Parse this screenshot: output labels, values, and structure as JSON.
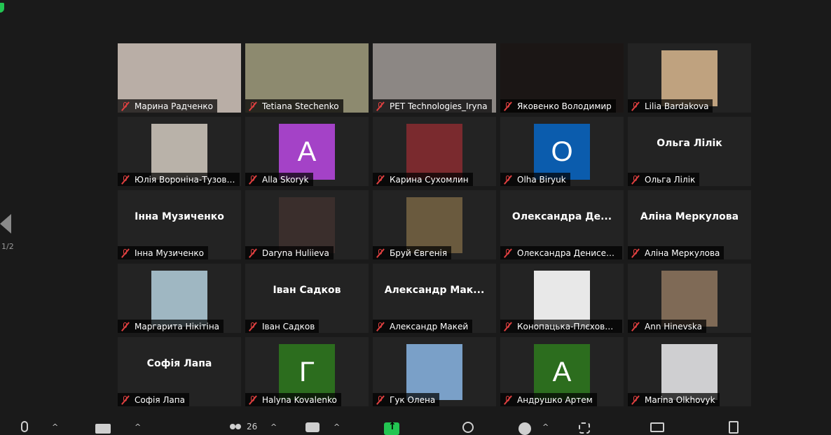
{
  "pagination": {
    "indicator": "1/2"
  },
  "toolbar": {
    "participants_count": "26",
    "caret": "^"
  },
  "colors": {
    "active_speaker_border": "#c6e36b",
    "muted_icon": "#e04040",
    "share_button": "#23c552"
  },
  "tiles": [
    {
      "name": "Марина Радченко",
      "kind": "video",
      "bg": "#b9aea6"
    },
    {
      "name": "Tetiana Stechenko",
      "kind": "video",
      "bg": "#8d8a6f"
    },
    {
      "name": "PET Technologies_Iryna",
      "kind": "video",
      "bg": "#8c8784",
      "active": true
    },
    {
      "name": "Яковенко Володимир",
      "kind": "video",
      "bg": "#1b1615"
    },
    {
      "name": "Lilia Bardakova",
      "kind": "photo",
      "bg": "#bfa27f"
    },
    {
      "name": "Юлія Вороніна-Тузовська",
      "kind": "photo",
      "bg": "#b9b2a9"
    },
    {
      "name": "Alla Skoryk",
      "kind": "initial",
      "initial": "A",
      "bg": "#a442c7"
    },
    {
      "name": "Карина Сухомлин",
      "kind": "photo",
      "bg": "#7a2a2e"
    },
    {
      "name": "Olha Biryuk",
      "kind": "initial",
      "initial": "O",
      "bg": "#0b5cad"
    },
    {
      "name": "Ольга Лілік",
      "kind": "text",
      "big": "Ольга Лілік"
    },
    {
      "name": "Інна Музиченко",
      "kind": "text",
      "big": "Інна Музиченко"
    },
    {
      "name": "Daryna Huliieva",
      "kind": "photo",
      "bg": "#3a2e2c"
    },
    {
      "name": "Бруй Євгенія",
      "kind": "photo",
      "bg": "#6a5a3e"
    },
    {
      "name": "Олександра Денисенко",
      "kind": "text",
      "big": "Олександра Де..."
    },
    {
      "name": "Аліна Меркулова",
      "kind": "text",
      "big": "Аліна Меркулова"
    },
    {
      "name": "Маргарита Нікітіна",
      "kind": "photo",
      "bg": "#9fb7c2"
    },
    {
      "name": "Іван Садков",
      "kind": "text",
      "big": "Іван Садков"
    },
    {
      "name": "Александр Макей",
      "kind": "text",
      "big": "Александр Мак..."
    },
    {
      "name": "Конопацька-ПлєховаО...",
      "kind": "photo",
      "bg": "#e8e8e8"
    },
    {
      "name": "Ann Hinevska",
      "kind": "photo",
      "bg": "#7f6a56"
    },
    {
      "name": "Софія Лапа",
      "kind": "text",
      "big": "Софія Лапа"
    },
    {
      "name": "Halyna Kovalenko",
      "kind": "initial",
      "initial": "Г",
      "bg": "#2c6d1e"
    },
    {
      "name": "Гук Олена",
      "kind": "photo",
      "bg": "#7aa0c8"
    },
    {
      "name": "Андрушко Артем",
      "kind": "initial",
      "initial": "A",
      "bg": "#2c6d1e"
    },
    {
      "name": "Marina Olkhovyk",
      "kind": "photo",
      "bg": "#cfcfd1"
    }
  ]
}
